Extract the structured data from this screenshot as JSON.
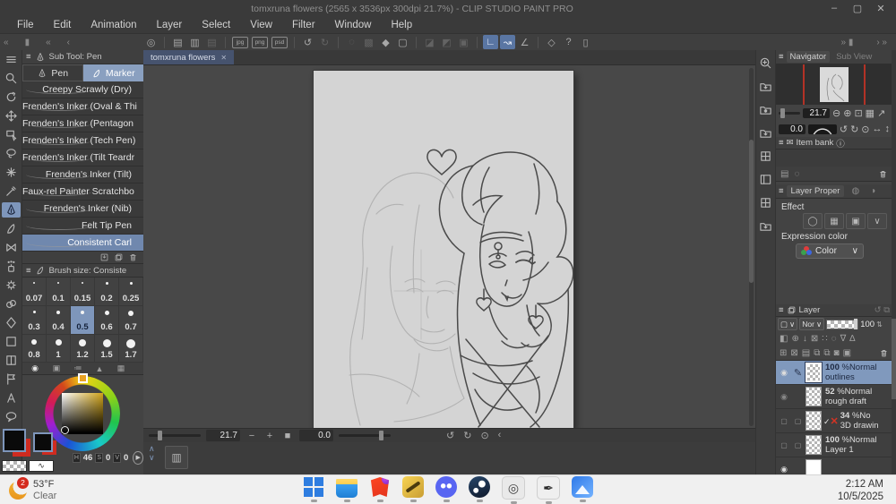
{
  "titlebar": {
    "title": "tomxruna flowers (2565 x 3536px 300dpi 21.7%)  - CLIP STUDIO PAINT PRO",
    "min": "–",
    "max": "▢",
    "close": "✕"
  },
  "menu": {
    "items": [
      "File",
      "Edit",
      "Animation",
      "Layer",
      "Select",
      "View",
      "Filter",
      "Window",
      "Help"
    ]
  },
  "toolbar": {
    "left_collapse": "«",
    "left_handle": "▮",
    "left_collapse2": "«",
    "left_arrow": "‹",
    "right_handle": "» ▮",
    "right_more": "›  »",
    "icons": [
      {
        "n": "clip-studio-icon",
        "g": "◎"
      },
      {
        "n": "sep",
        "cls": "sep"
      },
      {
        "n": "new-file-icon",
        "g": "▤"
      },
      {
        "n": "open-file-icon",
        "g": "▥"
      },
      {
        "n": "print-icon",
        "g": "▤",
        "cls": "dis"
      },
      {
        "n": "sep",
        "cls": "sep"
      },
      {
        "n": "export-jpg-icon",
        "g": "jpg",
        "cls": "file"
      },
      {
        "n": "export-png-icon",
        "g": "png",
        "cls": "file"
      },
      {
        "n": "export-psd-icon",
        "g": "psd",
        "cls": "file"
      },
      {
        "n": "sep",
        "cls": "sep"
      },
      {
        "n": "undo-icon",
        "g": "↺"
      },
      {
        "n": "redo-icon",
        "g": "↻",
        "cls": "dis"
      },
      {
        "n": "sep",
        "cls": "sep"
      },
      {
        "n": "deselect-icon",
        "g": "◌",
        "cls": "dis"
      },
      {
        "n": "select-extra-icon",
        "g": "▩",
        "cls": "dis"
      },
      {
        "n": "fill-icon",
        "g": "◆"
      },
      {
        "n": "transform-icon",
        "g": "▢"
      },
      {
        "n": "sep",
        "cls": "sep"
      },
      {
        "n": "mask-icon-1",
        "g": "◪",
        "cls": "dis"
      },
      {
        "n": "mask-icon-2",
        "g": "◩",
        "cls": "dis"
      },
      {
        "n": "mask-icon-3",
        "g": "▣",
        "cls": "dis"
      },
      {
        "n": "sep",
        "cls": "sep"
      },
      {
        "n": "snap-ruler-icon",
        "g": "∟",
        "cls": "act"
      },
      {
        "n": "snap-curve-icon",
        "g": "↝",
        "cls": "act"
      },
      {
        "n": "snap-grid-icon",
        "g": "∠"
      },
      {
        "n": "sep",
        "cls": "sep"
      },
      {
        "n": "material-icon",
        "g": "◇"
      },
      {
        "n": "help-icon",
        "g": "?"
      },
      {
        "n": "companion-icon",
        "g": "▯"
      }
    ]
  },
  "toolstrip": {
    "tools": [
      {
        "icon": "menu",
        "n": "palette-menu"
      },
      {
        "icon": "zoom",
        "n": "zoom-tool"
      },
      {
        "icon": "rotate",
        "n": "rotate-tool"
      },
      {
        "icon": "move",
        "n": "move-tool"
      },
      {
        "icon": "object",
        "n": "object-tool"
      },
      {
        "icon": "lasso",
        "n": "selection-tool"
      },
      {
        "icon": "wand",
        "n": "auto-select-tool"
      },
      {
        "icon": "dropper",
        "n": "eyedropper-tool"
      },
      {
        "icon": "pen",
        "n": "pen-tool",
        "cls": "sel"
      },
      {
        "icon": "brush",
        "n": "pencil-tool"
      },
      {
        "icon": "ribbon",
        "n": "decoration-tool"
      },
      {
        "icon": "airbrush",
        "n": "airbrush-tool"
      },
      {
        "icon": "gear",
        "n": "figure-tool"
      },
      {
        "icon": "blend",
        "n": "blend-tool"
      },
      {
        "icon": "eraser",
        "n": "eraser-tool"
      },
      {
        "icon": "frame",
        "n": "frame-tool"
      },
      {
        "icon": "grid2",
        "n": "divide-tool"
      },
      {
        "icon": "flag",
        "n": "flag-tool"
      },
      {
        "icon": "textA",
        "n": "text-tool"
      },
      {
        "icon": "balloon",
        "n": "balloon-tool"
      }
    ]
  },
  "subtool": {
    "menu_icon": "≡",
    "title": "Sub Tool: Pen",
    "tabs": [
      {
        "label": "Pen",
        "icon": "pen"
      },
      {
        "label": "Marker",
        "icon": "brush",
        "cls": "sel"
      }
    ],
    "brushes": [
      {
        "label": "Creepy Scrawly (Dry)"
      },
      {
        "label": "Frenden's Inker (Oval & Thi"
      },
      {
        "label": "Frenden's Inker (Pentagon"
      },
      {
        "label": "Frenden's Inker (Tech Pen)"
      },
      {
        "label": "Frenden's Inker (Tilt Teardr"
      },
      {
        "label": "Frenden's Inker (Tilt)"
      },
      {
        "label": "Faux-rel Painter Scratchbo"
      },
      {
        "label": "Frenden's Inker (Nib)"
      },
      {
        "label": "Felt Tip Pen"
      },
      {
        "label": "Consistent Carl",
        "cls": "sel"
      }
    ]
  },
  "brushsize": {
    "title": "Brush size: Consiste",
    "cells": [
      {
        "v": "0.07",
        "d": 2
      },
      {
        "v": "0.1",
        "d": 2
      },
      {
        "v": "0.15",
        "d": 2
      },
      {
        "v": "0.2",
        "d": 3
      },
      {
        "v": "0.25",
        "d": 3
      },
      {
        "v": "0.3",
        "d": 3
      },
      {
        "v": "0.4",
        "d": 4
      },
      {
        "v": "0.5",
        "d": 4,
        "cls": "sel"
      },
      {
        "v": "0.6",
        "d": 5
      },
      {
        "v": "0.7",
        "d": 6
      },
      {
        "v": "0.8",
        "d": 6,
        "cls": "half"
      },
      {
        "v": "1",
        "d": 7,
        "cls": "half"
      },
      {
        "v": "1.2",
        "d": 8,
        "cls": "half"
      },
      {
        "v": "1.5",
        "d": 9,
        "cls": "half"
      },
      {
        "v": "1.7",
        "d": 10,
        "cls": "half"
      }
    ]
  },
  "colorpanel": {
    "tabs": [
      {
        "g": "◉",
        "cls": "sel"
      },
      {
        "g": "▣"
      },
      {
        "g": "≔"
      },
      {
        "g": "▲"
      },
      {
        "g": "▦"
      }
    ],
    "h_label": "H",
    "h": "46",
    "s_label": "S",
    "s": "0",
    "v_label": "V",
    "v": "0",
    "play": "▶",
    "wave": "∿"
  },
  "canvas": {
    "tab": "tomxruna flowers",
    "close": "✕",
    "zoom": "21.7",
    "minus": "−",
    "plus": "+",
    "fit": "■",
    "rotation": "0.0",
    "rot_ccw": "↺",
    "rot_cw": "↻",
    "rot_reset": "⊙",
    "rot_more": "‹",
    "chev_up": "∧",
    "chev_dn": "∨",
    "timeline_icon": "▥"
  },
  "navigator": {
    "tab1": "Navigator",
    "tab2": "Sub View",
    "zoom": "21.7",
    "zoom_out": "⊖",
    "zoom_in": "⊕",
    "zoom_fit": "⊡",
    "btn_a": "▦",
    "btn_b": "↗",
    "rotation": "0.0",
    "rot_ccw": "↺",
    "rot_cw": "↻",
    "rot_reset": "⊙",
    "flip_h": "↔",
    "flip_v": "↕"
  },
  "itembank": {
    "icon": "✉",
    "title": "Item bank",
    "info": "ⓘ",
    "add": "▤",
    "ghost": "◌"
  },
  "layerprop": {
    "title": "Layer Proper",
    "tab_b": "◍",
    "tab_c": "◗",
    "effect": "Effect",
    "effect_icons": [
      {
        "g": "◯",
        "n": "border-effect-icon"
      },
      {
        "g": "▦",
        "n": "tone-effect-icon"
      },
      {
        "g": "▣",
        "n": "layer-color-icon"
      },
      {
        "g": "∨",
        "n": "effect-dropdown"
      }
    ],
    "expression": "Expression color",
    "color_btn": "Color",
    "caret": "∨"
  },
  "layerpanel": {
    "title": "Layer",
    "head_icons": "↺ ⧉",
    "blend_shape": "▢",
    "blend": "Nor",
    "caret": "∨",
    "opacity": "100",
    "stepper": "⇅",
    "icons1": [
      {
        "g": "◧"
      },
      {
        "g": "⊕"
      },
      {
        "g": "↓"
      },
      {
        "g": "⊠"
      },
      {
        "g": "∷"
      },
      {
        "g": "◌"
      },
      {
        "g": "∇"
      },
      {
        "g": "∆"
      }
    ],
    "icons2": [
      {
        "g": "⊞"
      },
      {
        "g": "⊠"
      },
      {
        "g": "▤"
      },
      {
        "g": "⧉"
      },
      {
        "g": "⧉"
      },
      {
        "g": "◙"
      },
      {
        "g": "▣"
      }
    ],
    "layers": [
      {
        "opacity": "100",
        "mode": "%Normal",
        "name": "outlines",
        "cls": "sel",
        "eye": "on",
        "edit": "pencil",
        "thumb": "checker",
        "mark1": "",
        "mark2": ""
      },
      {
        "opacity": "52",
        "mode": "%Normal",
        "name": "rough draft",
        "cls": "",
        "eye": "dim",
        "edit": "",
        "thumb": "checker",
        "mark1": "",
        "mark2": ""
      },
      {
        "opacity": "34",
        "mode": "%No",
        "name": "3D drawin",
        "cls": "",
        "eye": "box",
        "edit": "box",
        "thumb": "checker",
        "mark1": "✓",
        "mark2": "✕"
      },
      {
        "opacity": "100",
        "mode": "%Normal",
        "name": "Layer 1",
        "cls": "",
        "eye": "box",
        "edit": "box",
        "thumb": "checker",
        "mark1": "",
        "mark2": ""
      },
      {
        "opacity": "",
        "mode": "",
        "name": "",
        "cls": "",
        "eye": "on",
        "edit": "",
        "thumb": "paper",
        "mark1": "",
        "mark2": ""
      }
    ]
  },
  "rstrip": {
    "icons": [
      {
        "icon": "qzoom",
        "n": "quick-access-icon"
      },
      {
        "icon": "folderdl",
        "n": "download-panel-icon"
      },
      {
        "icon": "folderstar",
        "n": "material-favorites-icon"
      },
      {
        "icon": "folderdl",
        "n": "material-download-icon"
      },
      {
        "icon": "grid",
        "n": "material-grid-icon"
      },
      {
        "icon": "panel",
        "n": "panel-icon"
      },
      {
        "icon": "grid",
        "n": "material-grid-icon-2"
      },
      {
        "icon": "folderdl",
        "n": "material-folder-icon"
      }
    ]
  },
  "taskbar": {
    "weather": {
      "badge": "2",
      "temp": "53°F",
      "cond": "Clear"
    },
    "apps": [
      {
        "cls": "app-start",
        "n": "start-button"
      },
      {
        "cls": "app-explorer",
        "n": "file-explorer"
      },
      {
        "cls": "app-brave",
        "n": "brave-browser"
      },
      {
        "cls": "app-paint",
        "n": "paint-app"
      },
      {
        "cls": "app-discord",
        "n": "discord"
      },
      {
        "cls": "app-steam",
        "n": "steam"
      },
      {
        "cls": "app-clip1",
        "n": "clip-studio",
        "g": "◎"
      },
      {
        "cls": "app-clip2",
        "n": "clip-studio-paint",
        "g": "✒"
      },
      {
        "cls": "app-photos",
        "n": "photos"
      }
    ],
    "clock": {
      "time": "2:12 AM",
      "date": "10/5/2025"
    }
  }
}
